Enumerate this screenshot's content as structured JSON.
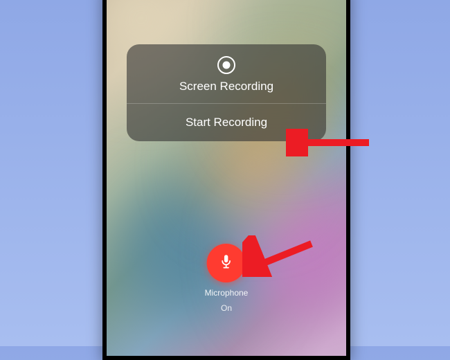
{
  "panel": {
    "title": "Screen Recording",
    "action_label": "Start Recording"
  },
  "microphone": {
    "label": "Microphone",
    "status": "On"
  },
  "colors": {
    "mic_button": "#ff3b30",
    "arrow": "#ec1c24"
  }
}
